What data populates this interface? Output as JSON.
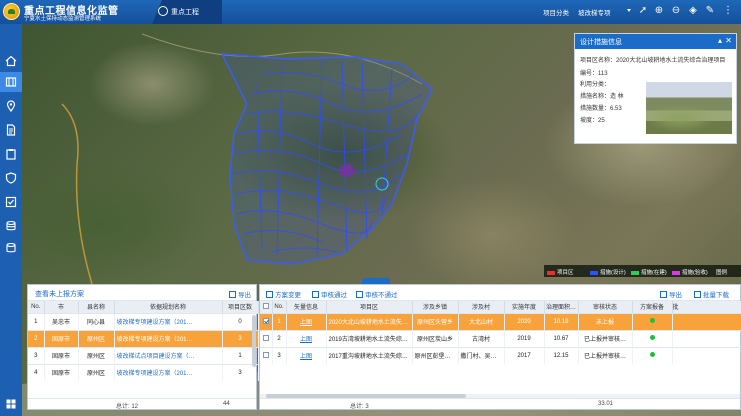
{
  "header": {
    "title": "重点工程信息化监管",
    "subtitle": "宁夏水土保持动态监测管理系统",
    "tab_label": "重点工程",
    "category_label": "项目分类",
    "category_value": "坡改梯专项"
  },
  "sidebar": {
    "items": [
      "home-icon",
      "map-icon",
      "location-icon",
      "document-icon",
      "clipboard-icon",
      "shield-icon",
      "checklist-icon",
      "database-icon",
      "layers-icon"
    ]
  },
  "info_panel": {
    "title": "设计措施信息",
    "project_name": "项目区名称：2020大北山坡耕地水土流失综合治理项目",
    "code": "编号：113",
    "usage": "利用分类：",
    "measure_name": "措施名称：造 林",
    "measure_count": "措施数量：6.53",
    "slope": "坡度：25"
  },
  "legend": [
    {
      "label": "项目区",
      "color": "#e8322c"
    },
    {
      "label": "措施(设计)",
      "color": "#2a54ff"
    },
    {
      "label": "措施(在建)",
      "color": "#2fd05a"
    },
    {
      "label": "措施(验收)",
      "color": "#d43ae6"
    },
    {
      "label": "图例",
      "color": "#ffffff"
    }
  ],
  "left_panel": {
    "view_link": "查看未上报方案",
    "export": "导出",
    "columns": [
      "No.",
      "市",
      "县名称",
      "依据规划名称",
      "项目区数"
    ],
    "rows": [
      [
        "1",
        "吴忠市",
        "同心县",
        "坡改梯专项建设方案（201…",
        "0"
      ],
      [
        "2",
        "固原市",
        "原州区",
        "坡改梯专项建设方案（201…",
        "3"
      ],
      [
        "3",
        "固原市",
        "原州区",
        "坡改梯试点项目建设方案（…",
        "1"
      ],
      [
        "4",
        "固原市",
        "原州区",
        "坡改梯专项建设方案（201…",
        "3"
      ]
    ],
    "footer_label": "总计: 12",
    "footer_value": "44"
  },
  "right_panel": {
    "buttons": [
      "方案变更",
      "审核通过",
      "审核不通过",
      "导出",
      "批量下载"
    ],
    "columns": [
      "",
      "No.",
      "矢量信息",
      "项目区",
      "涉及乡镇",
      "涉及村",
      "实施年度",
      "治理面积…",
      "审核状态",
      "方案报备",
      "批"
    ],
    "rows": [
      [
        "1",
        "上图",
        "2020大北山坡耕地水土流失…",
        "原州区头营乡",
        "大北山村",
        "2020",
        "10.19",
        "未上报"
      ],
      [
        "2",
        "上图",
        "2019古湾坡耕地水土流失综…",
        "原州区炭山乡",
        "古湾村",
        "2019",
        "10.67",
        "已上报并审核…"
      ],
      [
        "3",
        "上图",
        "2017重沟坡耕地水土流失综…",
        "原州区彭堡、…",
        "撒门村、吴磨…",
        "2017",
        "12.15",
        "已上报并审核…"
      ]
    ],
    "footer_label": "总计: 3",
    "footer_value": "33.01"
  }
}
